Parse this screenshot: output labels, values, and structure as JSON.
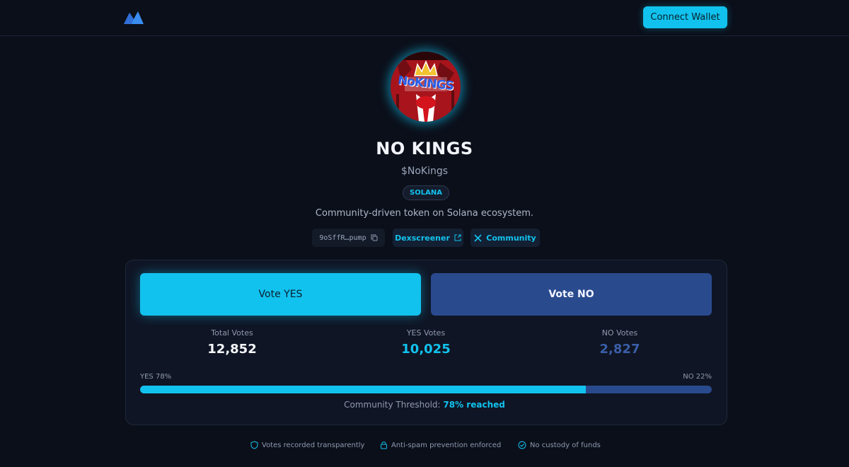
{
  "header": {
    "logo_icon": "mountain-logo-icon",
    "connect_label": "Connect Wallet"
  },
  "token": {
    "avatar_text": "NoKINGS",
    "name": "NO KINGS",
    "ticker": "$NoKings",
    "chain": "SOLANA",
    "description": "Community-driven token on Solana ecosystem.",
    "address": "9oSffR…pump",
    "dex_label": "Dexscreener",
    "community_label": "Community"
  },
  "vote": {
    "yes_label": "Vote YES",
    "no_label": "Vote NO"
  },
  "stats": {
    "total_label": "Total Votes",
    "total_value": "12,852",
    "yes_label": "YES Votes",
    "yes_value": "10,025",
    "no_label": "NO Votes",
    "no_value": "2,827"
  },
  "progress": {
    "yes_text": "YES 78%",
    "no_text": "NO 22%",
    "yes_percent": 78,
    "threshold_label": "Community Threshold:",
    "threshold_value": "78% reached"
  },
  "footer": {
    "item1": "Votes recorded transparently",
    "item2": "Anti-spam prevention enforced",
    "item3": "No custody of funds"
  },
  "colors": {
    "accent": "#12c2ee",
    "no_blue": "#2a4a8e",
    "background": "#0b0f1a"
  }
}
